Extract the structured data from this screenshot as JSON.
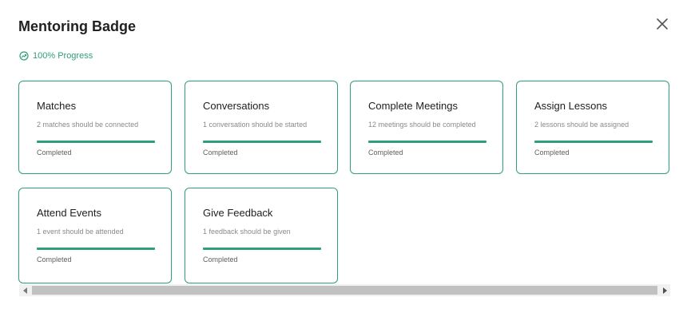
{
  "dialog": {
    "title": "Mentoring Badge",
    "progress_label": "100% Progress",
    "close_icon": "close-icon",
    "progress_icon": "trend-up-circle-icon"
  },
  "colors": {
    "accent": "#2e9e7d",
    "card_border": "#2e9e7d",
    "text": "#212121",
    "muted": "#8a8a8a"
  },
  "cards": [
    {
      "title": "Matches",
      "description": "2 matches should be connected",
      "status": "Completed",
      "progress": 1.0
    },
    {
      "title": "Conversations",
      "description": "1 conversation should be started",
      "status": "Completed",
      "progress": 1.0
    },
    {
      "title": "Complete Meetings",
      "description": "12 meetings should be completed",
      "status": "Completed",
      "progress": 1.0
    },
    {
      "title": "Assign Lessons",
      "description": "2 lessons should be assigned",
      "status": "Completed",
      "progress": 1.0
    },
    {
      "title": "Attend Events",
      "description": "1 event should be attended",
      "status": "Completed",
      "progress": 1.0
    },
    {
      "title": "Give Feedback",
      "description": "1 feedback should be given",
      "status": "Completed",
      "progress": 1.0
    }
  ]
}
